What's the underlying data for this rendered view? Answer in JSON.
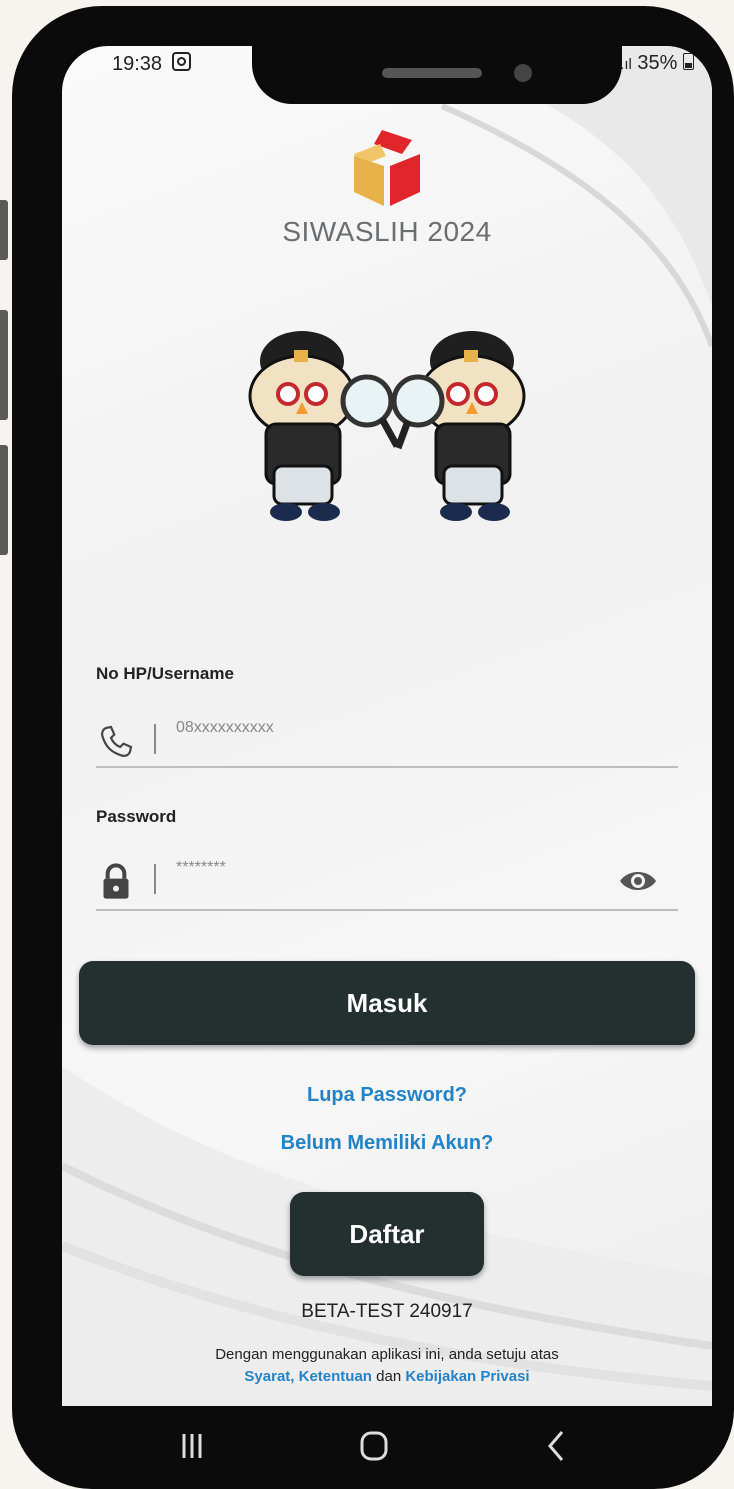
{
  "status_bar": {
    "time": "19:38",
    "signal": ".ıl",
    "battery": "35%"
  },
  "app": {
    "title": "SIWASLIH 2024"
  },
  "form": {
    "username": {
      "label": "No HP/Username",
      "placeholder": "08xxxxxxxxxx",
      "icon": "phone-icon"
    },
    "password": {
      "label": "Password",
      "placeholder": "********",
      "icon": "lock-icon",
      "toggle_icon": "eye-icon"
    }
  },
  "actions": {
    "login_label": "Masuk",
    "forgot_password": "Lupa Password?",
    "no_account": "Belum Memiliki Akun?",
    "register_label": "Daftar"
  },
  "footer": {
    "version": "BETA-TEST 240917",
    "terms_prefix": "Dengan menggunakan aplikasi ini, anda setuju atas",
    "terms_link": "Syarat, Ketentuan",
    "terms_and": "dan",
    "privacy_link": "Kebijakan Privasi"
  },
  "colors": {
    "button_bg": "#242f2f",
    "link": "#2383c7",
    "logo_red": "#e0262a",
    "logo_gold": "#e7b24a"
  }
}
